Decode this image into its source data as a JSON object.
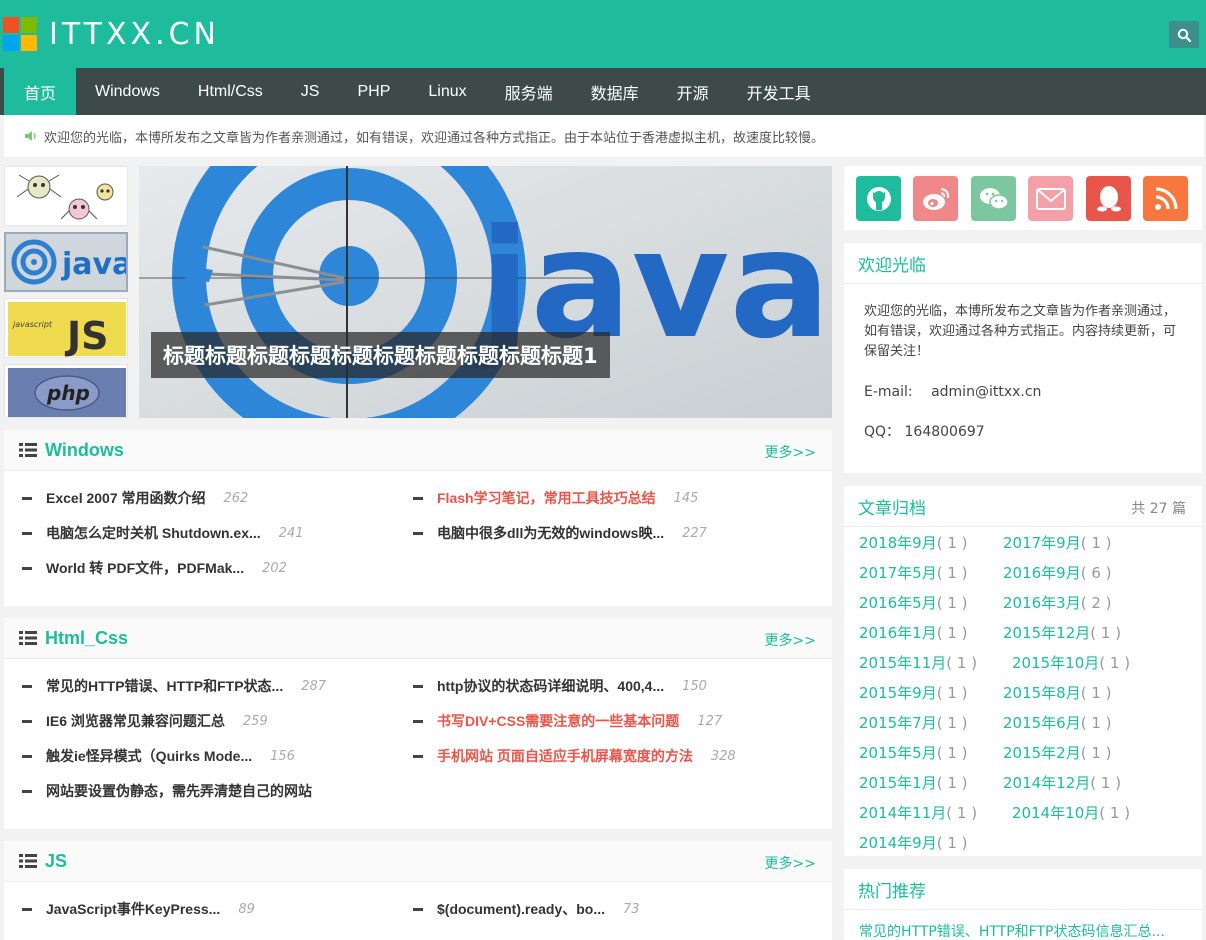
{
  "header": {
    "logo_text": "ITTXX.CN",
    "search_icon": "search-icon"
  },
  "nav": {
    "items": [
      "首页",
      "Windows",
      "Html/Css",
      "JS",
      "PHP",
      "Linux",
      "服务端",
      "数据库",
      "开源",
      "开发工具"
    ]
  },
  "notice": {
    "icon": "speaker-icon",
    "text": "欢迎您的光临，本博所发布之文章皆为作者亲测通过，如有错误，欢迎通过各种方式指正。由于本站位于香港虚拟主机，故速度比较慢。"
  },
  "slider": {
    "caption": "标题标题标题标题标题标题标题标题标题标题1",
    "image_word": "java",
    "thumbs": [
      "spiders",
      "java",
      "JS",
      "php"
    ],
    "thumb_labels": {
      "js_small": "javascript",
      "js_big": "JS",
      "php": "php",
      "java": "java"
    }
  },
  "panels": [
    {
      "title": "Windows",
      "more": "更多>>",
      "articles": [
        {
          "title": "Excel 2007 常用函数介绍",
          "views": "262",
          "hot": false
        },
        {
          "title": "Flash学习笔记，常用工具技巧总结",
          "views": "145",
          "hot": true
        },
        {
          "title": "电脑怎么定时关机 Shutdown.ex...",
          "views": "241",
          "hot": false
        },
        {
          "title": "电脑中很多dll为无效的windows映...",
          "views": "227",
          "hot": false
        },
        {
          "title": "World 转 PDF文件，PDFMak...",
          "views": "202",
          "hot": false
        }
      ]
    },
    {
      "title": "Html_Css",
      "more": "更多>>",
      "articles": [
        {
          "title": "常见的HTTP错误、HTTP和FTP状态...",
          "views": "287",
          "hot": false
        },
        {
          "title": "http协议的状态码详细说明、400,4...",
          "views": "150",
          "hot": false
        },
        {
          "title": "IE6 浏览器常见兼容问题汇总",
          "views": "259",
          "hot": false
        },
        {
          "title": "书写DIV+CSS需要注意的一些基本问题",
          "views": "127",
          "hot": true
        },
        {
          "title": "触发ie怪异模式（Quirks Mode...",
          "views": "156",
          "hot": false
        },
        {
          "title": "手机网站 页面自适应手机屏幕宽度的方法",
          "views": "328",
          "hot": true
        },
        {
          "title": "网站要设置伪静态，需先弄清楚自己的网站",
          "views": "",
          "hot": false
        }
      ]
    },
    {
      "title": "JS",
      "more": "更多>>",
      "articles": [
        {
          "title": "JavaScript事件KeyPress...",
          "views": "89",
          "hot": false
        },
        {
          "title": "$(document).ready、bo...",
          "views": "73",
          "hot": false
        }
      ]
    }
  ],
  "social": {
    "icons": [
      {
        "name": "github-icon",
        "color": "#1ebc9c"
      },
      {
        "name": "weibo-icon",
        "color": "#f0888a"
      },
      {
        "name": "wechat-icon",
        "color": "#7dc7a0"
      },
      {
        "name": "mail-icon",
        "color": "#f4a0a8"
      },
      {
        "name": "qq-icon",
        "color": "#e8564b"
      },
      {
        "name": "rss-icon",
        "color": "#f7773e"
      }
    ]
  },
  "welcome": {
    "title": "欢迎光临",
    "body": "欢迎您的光临，本博所发布之文章皆为作者亲测通过，如有错误，欢迎通过各种方式指正。内容持续更新，可保留关注！",
    "email_label": "E-mail:",
    "email": "admin@ittxx.cn",
    "qq_label": "QQ：",
    "qq": "164800697"
  },
  "archive": {
    "title": "文章归档",
    "count": "共 27 篇",
    "rows": [
      [
        {
          "m": "2018年9月",
          "c": "( 1 )"
        },
        {
          "m": "2017年9月",
          "c": "( 1 )"
        }
      ],
      [
        {
          "m": "2017年5月",
          "c": "( 1 )"
        },
        {
          "m": "2016年9月",
          "c": "( 6 )"
        }
      ],
      [
        {
          "m": "2016年5月",
          "c": "( 1 )"
        },
        {
          "m": "2016年3月",
          "c": "( 2 )"
        }
      ],
      [
        {
          "m": "2016年1月",
          "c": "( 1 )"
        },
        {
          "m": "2015年12月",
          "c": "( 1 )"
        }
      ],
      [
        {
          "m": "2015年11月",
          "c": "( 1 )"
        },
        {
          "m": "2015年10月",
          "c": "( 1 )"
        }
      ],
      [
        {
          "m": "2015年9月",
          "c": "( 1 )"
        },
        {
          "m": "2015年8月",
          "c": "( 1 )"
        }
      ],
      [
        {
          "m": "2015年7月",
          "c": "( 1 )"
        },
        {
          "m": "2015年6月",
          "c": "( 1 )"
        }
      ],
      [
        {
          "m": "2015年5月",
          "c": "( 1 )"
        },
        {
          "m": "2015年2月",
          "c": "( 1 )"
        }
      ],
      [
        {
          "m": "2015年1月",
          "c": "( 1 )"
        },
        {
          "m": "2014年12月",
          "c": "( 1 )"
        }
      ],
      [
        {
          "m": "2014年11月",
          "c": "( 1 )"
        },
        {
          "m": "2014年10月",
          "c": "( 1 )"
        }
      ],
      [
        {
          "m": "2014年9月",
          "c": "( 1 )"
        }
      ]
    ]
  },
  "hot": {
    "title": "热门推荐",
    "first": "常见的HTTP错误、HTTP和FTP状态码信息汇总..."
  }
}
